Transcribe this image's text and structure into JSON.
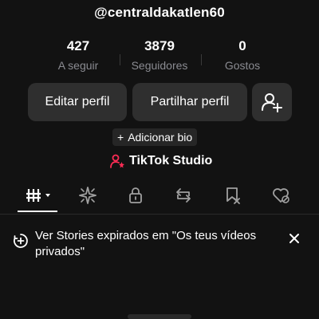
{
  "profile": {
    "username": "@centraldakatlen60"
  },
  "stats": [
    {
      "value": "427",
      "label": "A seguir"
    },
    {
      "value": "3879",
      "label": "Seguidores"
    },
    {
      "value": "0",
      "label": "Gostos"
    }
  ],
  "actions": {
    "edit_label": "Editar perfil",
    "share_label": "Partilhar perfil",
    "add_friend_icon": "person-plus-icon"
  },
  "bio": {
    "add_label": "Adicionar bio",
    "plus_symbol": "+"
  },
  "studio": {
    "label": "TikTok Studio",
    "icon": "studio-icon",
    "accent_color": "#fe2c55"
  },
  "tabs": [
    {
      "name": "videos",
      "icon": "grid-icon",
      "active": true
    },
    {
      "name": "reposts",
      "icon": "sparkle-icon",
      "active": false
    },
    {
      "name": "private",
      "icon": "lock-icon",
      "active": false
    },
    {
      "name": "repost",
      "icon": "repeat-icon",
      "active": false
    },
    {
      "name": "favorites",
      "icon": "bookmark-icon",
      "active": false
    },
    {
      "name": "liked",
      "icon": "heart-icon",
      "active": false
    }
  ],
  "notice": {
    "text": "Ver Stories expirados em \"Os teus vídeos privados\"",
    "icon": "story-plus-icon",
    "close_icon": "close-icon"
  }
}
